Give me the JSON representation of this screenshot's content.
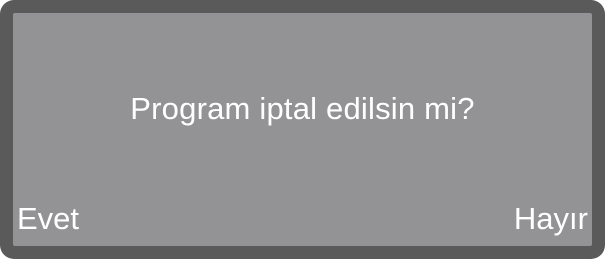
{
  "display": {
    "prompt": "Program iptal edilsin mi?",
    "left_softkey": "Evet",
    "right_softkey": "Hayır"
  },
  "colors": {
    "bezel": "#5a5a5b",
    "screen": "#939395",
    "text": "#ffffff"
  }
}
